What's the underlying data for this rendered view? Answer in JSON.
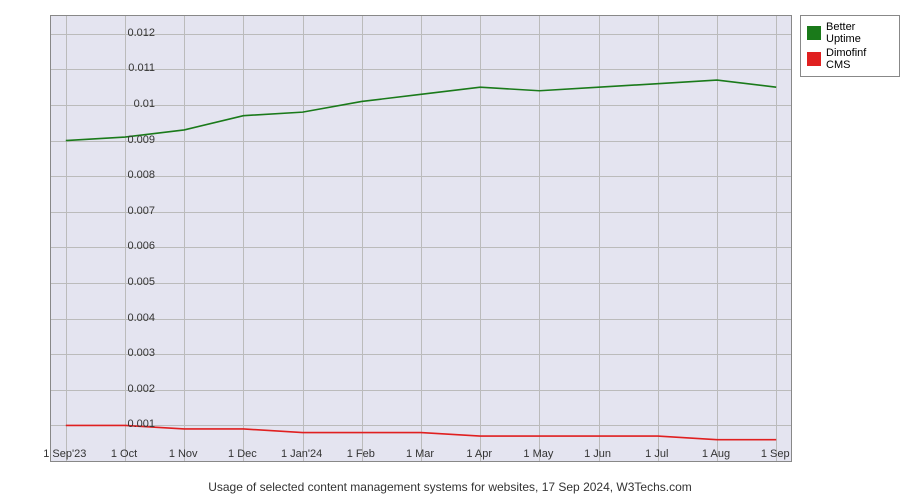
{
  "chart_data": {
    "type": "line",
    "title": "",
    "xlabel": "",
    "ylabel": "",
    "ylim": [
      0,
      0.0125
    ],
    "categories": [
      "1 Sep'23",
      "1 Oct",
      "1 Nov",
      "1 Dec",
      "1 Jan'24",
      "1 Feb",
      "1 Mar",
      "1 Apr",
      "1 May",
      "1 Jun",
      "1 Jul",
      "1 Aug",
      "1 Sep"
    ],
    "series": [
      {
        "name": "Better Uptime",
        "color": "#1a7a1a",
        "values": [
          0.009,
          0.0091,
          0.0093,
          0.0097,
          0.0098,
          0.0101,
          0.0103,
          0.0105,
          0.0104,
          0.0105,
          0.0106,
          0.0107,
          0.0105
        ]
      },
      {
        "name": "Dimofinf CMS",
        "color": "#e02020",
        "values": [
          0.001,
          0.001,
          0.0009,
          0.0009,
          0.0008,
          0.0008,
          0.0008,
          0.0007,
          0.0007,
          0.0007,
          0.0007,
          0.0006,
          0.0006
        ]
      }
    ],
    "y_ticks": [
      0.001,
      0.002,
      0.003,
      0.004,
      0.005,
      0.006,
      0.007,
      0.008,
      0.009,
      0.01,
      0.011,
      0.012
    ]
  },
  "caption": "Usage of selected content management systems for websites, 17 Sep 2024, W3Techs.com",
  "legend": {
    "items": [
      {
        "label": "Better Uptime",
        "color": "#1a7a1a"
      },
      {
        "label": "Dimofinf CMS",
        "color": "#e02020"
      }
    ]
  }
}
